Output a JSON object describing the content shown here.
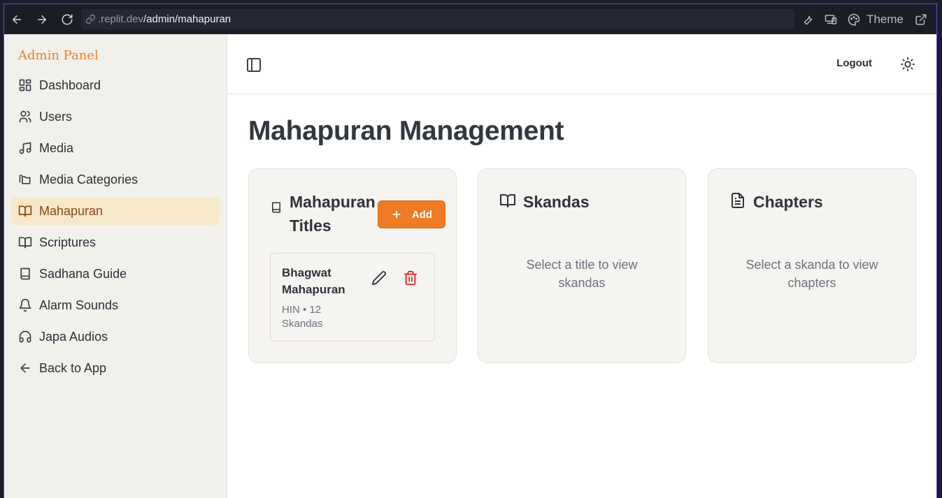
{
  "browser": {
    "url_host": ".replit.dev",
    "url_path": "/admin/mahapuran",
    "theme_label": "Theme"
  },
  "sidebar": {
    "brand": "Admin Panel",
    "items": [
      {
        "label": "Dashboard",
        "icon": "dashboard-icon"
      },
      {
        "label": "Users",
        "icon": "users-icon"
      },
      {
        "label": "Media",
        "icon": "music-icon"
      },
      {
        "label": "Media Categories",
        "icon": "folders-icon"
      },
      {
        "label": "Mahapuran",
        "icon": "book-open-icon",
        "active": true
      },
      {
        "label": "Scriptures",
        "icon": "book-open-icon"
      },
      {
        "label": "Sadhana Guide",
        "icon": "book-icon"
      },
      {
        "label": "Alarm Sounds",
        "icon": "bell-icon"
      },
      {
        "label": "Japa Audios",
        "icon": "headphones-icon"
      },
      {
        "label": "Back to App",
        "icon": "arrow-left-icon"
      }
    ]
  },
  "topbar": {
    "logout_label": "Logout"
  },
  "main": {
    "title": "Mahapuran Management",
    "cards": {
      "titles": {
        "heading": "Mahapuran Titles",
        "add_label": "Add",
        "items": [
          {
            "title": "Bhagwat Mahapuran",
            "meta": "HIN • 12 Skandas"
          }
        ]
      },
      "skandas": {
        "heading": "Skandas",
        "empty": "Select a title to view skandas"
      },
      "chapters": {
        "heading": "Chapters",
        "empty": "Select a skanda to view chapters"
      }
    }
  },
  "colors": {
    "accent": "#ef7b25",
    "active_bg": "#f7e8c9",
    "danger": "#e02424"
  }
}
